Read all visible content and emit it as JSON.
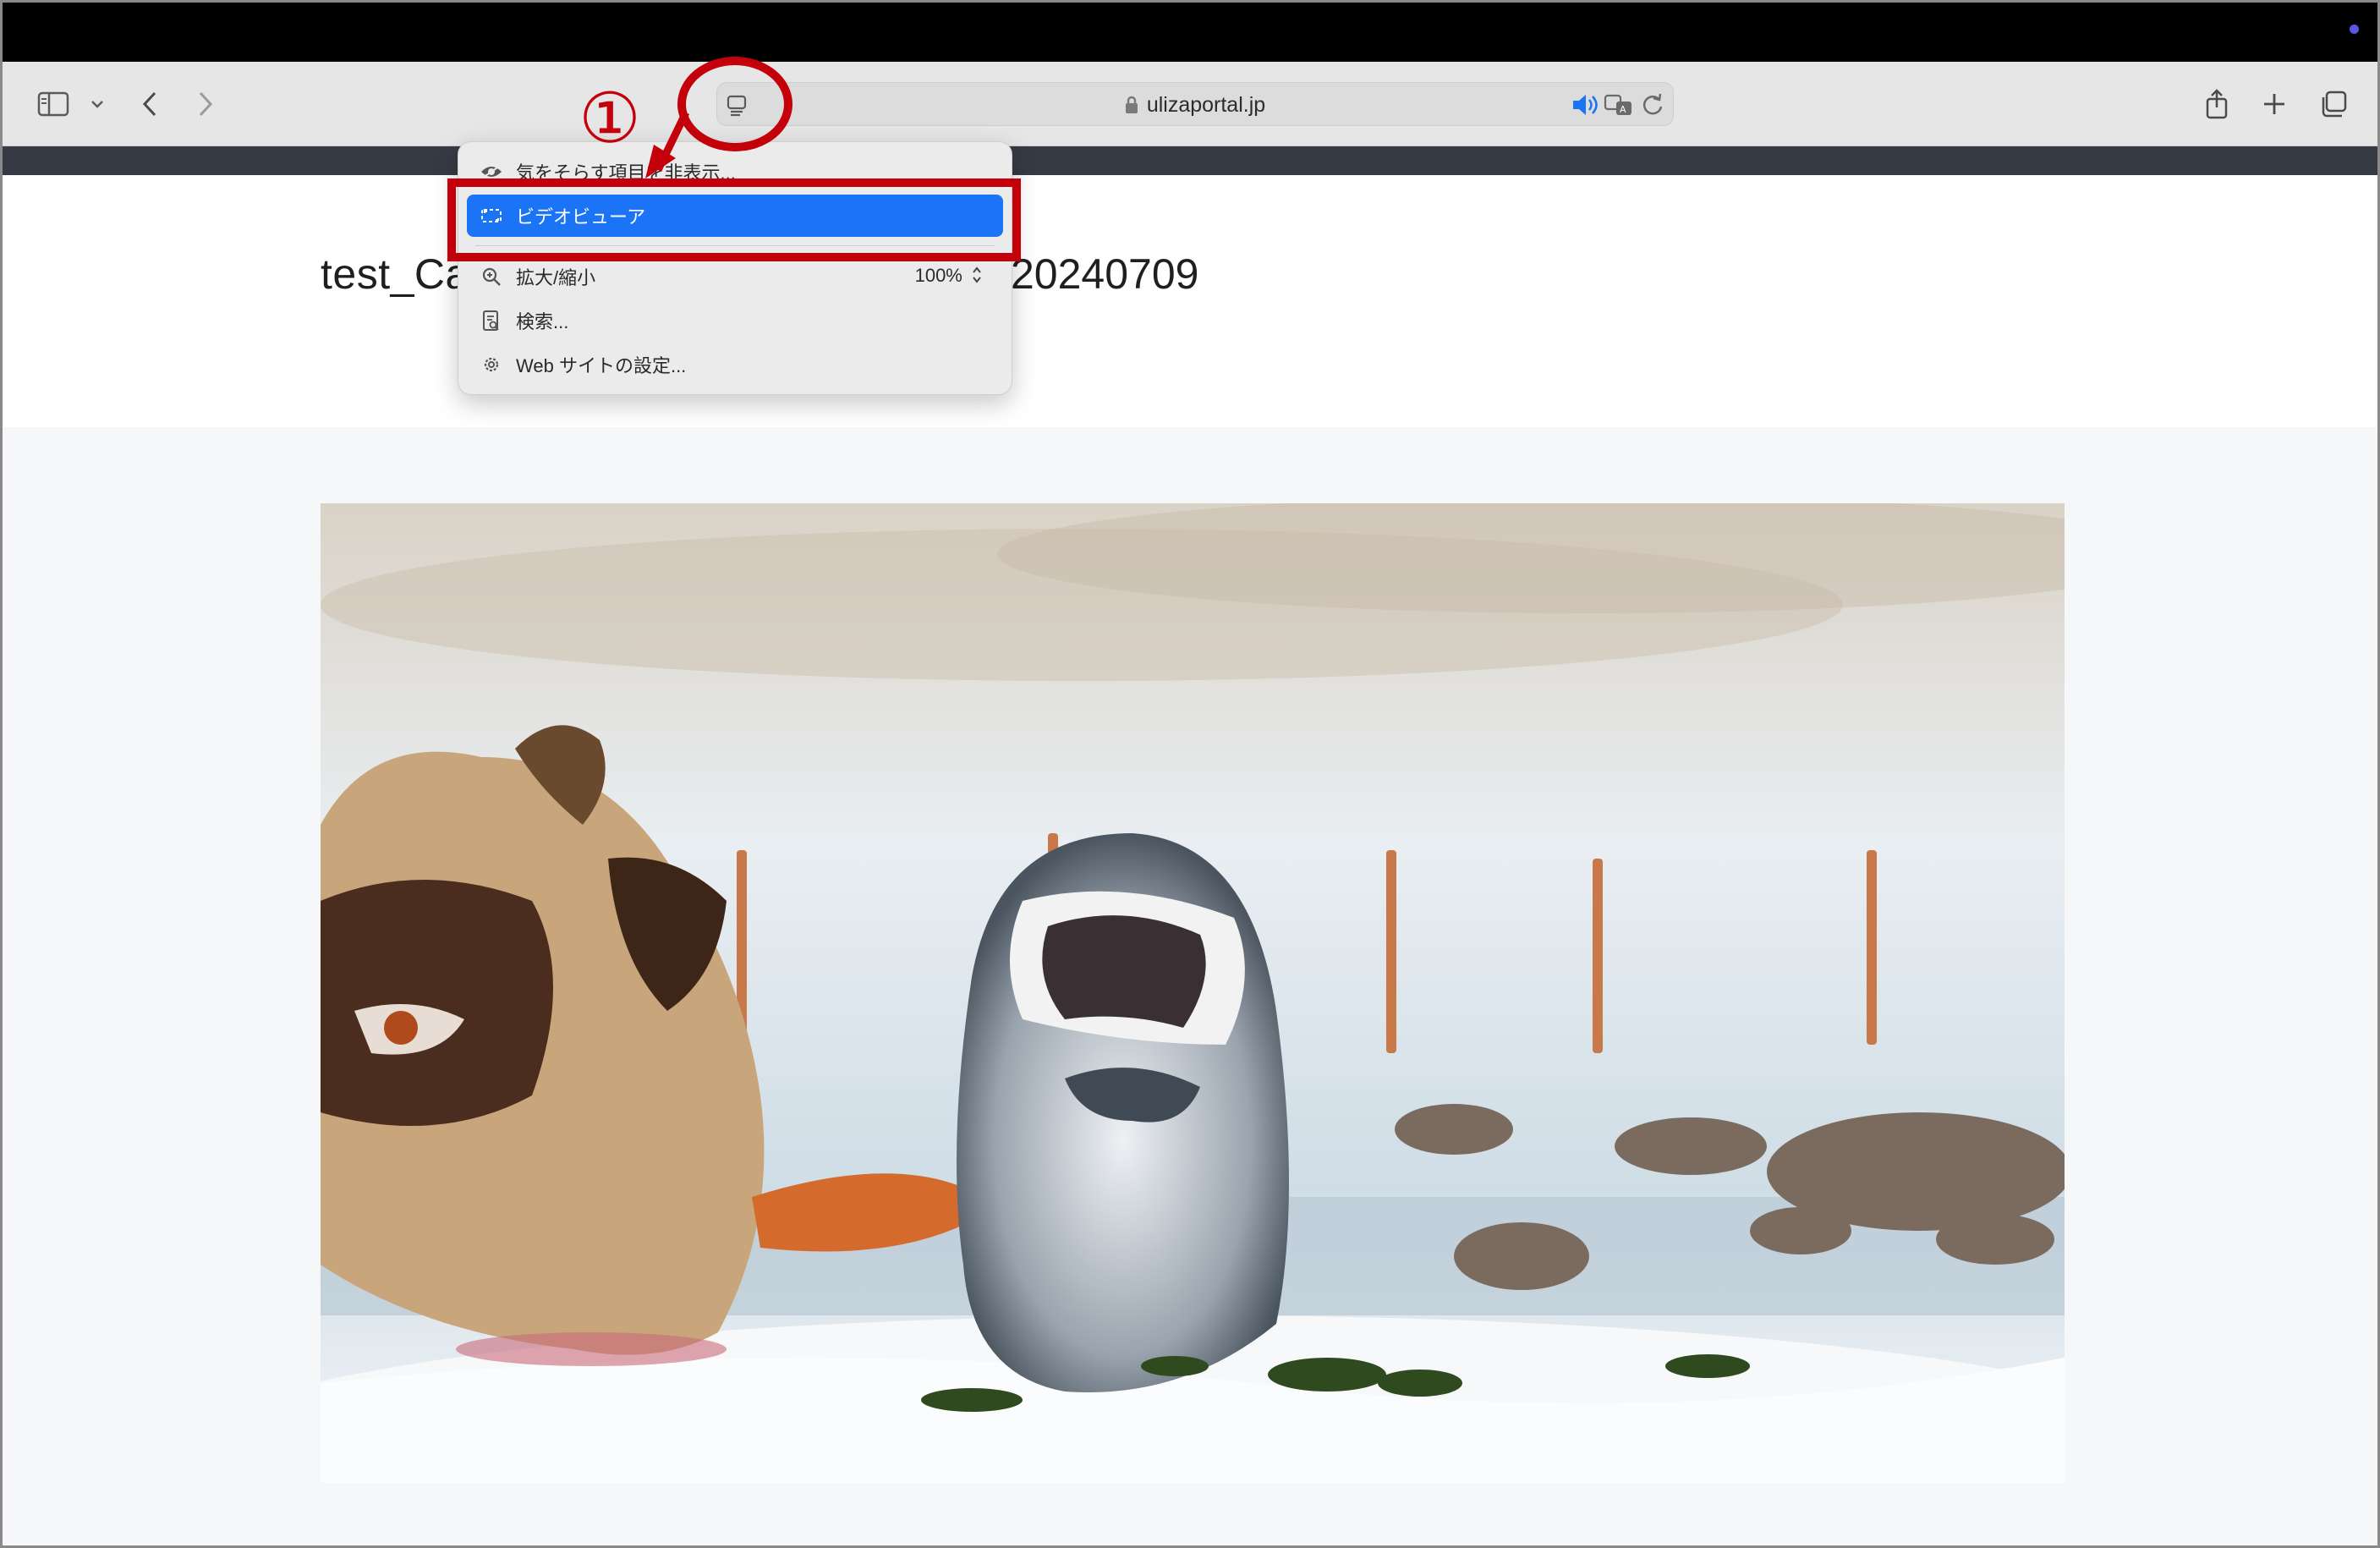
{
  "browser": {
    "address": "ulizaportal.jp",
    "colors": {
      "accent": "#1a74f5",
      "annotation": "#c4000a",
      "menubar": "#000000",
      "toolbar": "#e6e6e6"
    }
  },
  "page": {
    "title_visible_left": "test_Ca",
    "title_visible_right": "20240709"
  },
  "menu": {
    "items": [
      {
        "label": "気をそらす項目を非表示...",
        "icon": "eye-icon"
      },
      {
        "label": "ビデオビューア",
        "icon": "video-viewer-icon",
        "selected": true
      },
      {
        "label": "拡大/縮小",
        "icon": "zoom-icon",
        "value": "100%"
      },
      {
        "label": "検索...",
        "icon": "find-icon"
      },
      {
        "label": "Web サイトの設定...",
        "icon": "gear-icon"
      }
    ]
  },
  "annotation": {
    "step_label": "①"
  }
}
